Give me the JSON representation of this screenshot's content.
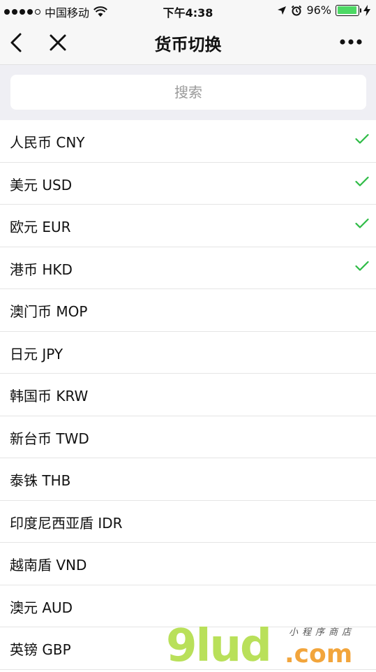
{
  "status_bar": {
    "carrier": "中国移动",
    "time": "下午4:38",
    "battery_percent": "96%",
    "battery_level": 0.96,
    "signal_dots": 5,
    "icons": [
      "signal-dots-icon",
      "wifi-icon",
      "location-arrow-icon",
      "alarm-icon",
      "battery-icon",
      "charging-icon"
    ]
  },
  "nav": {
    "title": "货币切换",
    "back_icon": "chevron-left-icon",
    "close_icon": "close-icon",
    "more_icon": "more-dots-icon"
  },
  "search": {
    "placeholder": "搜索"
  },
  "currencies": [
    {
      "label": "人民币 CNY",
      "checked": true
    },
    {
      "label": "美元 USD",
      "checked": true
    },
    {
      "label": "欧元 EUR",
      "checked": true
    },
    {
      "label": "港币 HKD",
      "checked": true
    },
    {
      "label": "澳门币 MOP",
      "checked": false
    },
    {
      "label": "日元 JPY",
      "checked": false
    },
    {
      "label": "韩国币 KRW",
      "checked": false
    },
    {
      "label": "新台币 TWD",
      "checked": false
    },
    {
      "label": "泰铢 THB",
      "checked": false
    },
    {
      "label": "印度尼西亚盾 IDR",
      "checked": false
    },
    {
      "label": "越南盾 VND",
      "checked": false
    },
    {
      "label": "澳元 AUD",
      "checked": false
    },
    {
      "label": "英镑 GBP",
      "checked": false
    }
  ],
  "watermark": {
    "brand": "9lud",
    "domain": ".com",
    "tagline": "小程序商店"
  },
  "colors": {
    "check": "#2dbb45",
    "battery_fill": "#4cd964",
    "bar_bg": "#f7f7f7",
    "search_bg": "#efeff4"
  }
}
